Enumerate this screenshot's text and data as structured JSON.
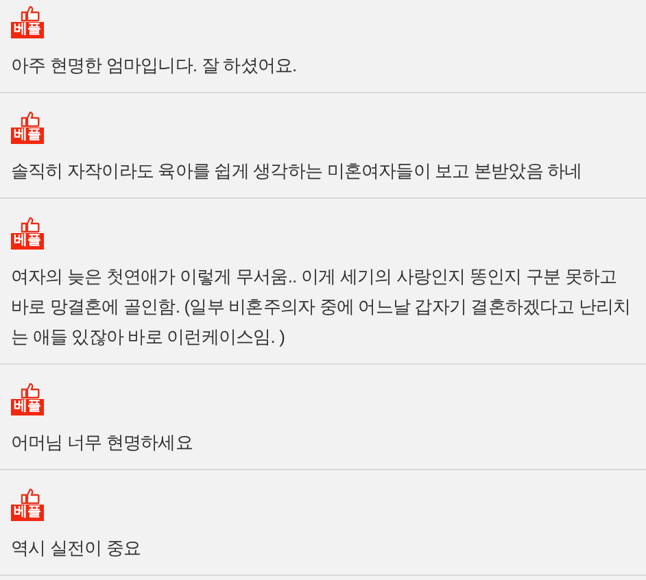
{
  "comments": [
    {
      "badge": "베플",
      "text": "아주 현명한 엄마입니다. 잘 하셨어요."
    },
    {
      "badge": "베플",
      "text": "솔직히 자작이라도 육아를 쉽게 생각하는 미혼여자들이 보고 본받았음 하네"
    },
    {
      "badge": "베플",
      "text": "여자의 늦은 첫연애가 이렇게 무서움.. 이게 세기의 사랑인지 똥인지 구분 못하고 바로 망결혼에 골인함. (일부 비혼주의자 중에 어느날 갑자기 결혼하겠다고 난리치는 애들 있잖아 바로 이런케이스임. )"
    },
    {
      "badge": "베플",
      "text": "어머님 너무 현명하세요"
    },
    {
      "badge": "베플",
      "text": "역시 실전이 중요"
    }
  ]
}
